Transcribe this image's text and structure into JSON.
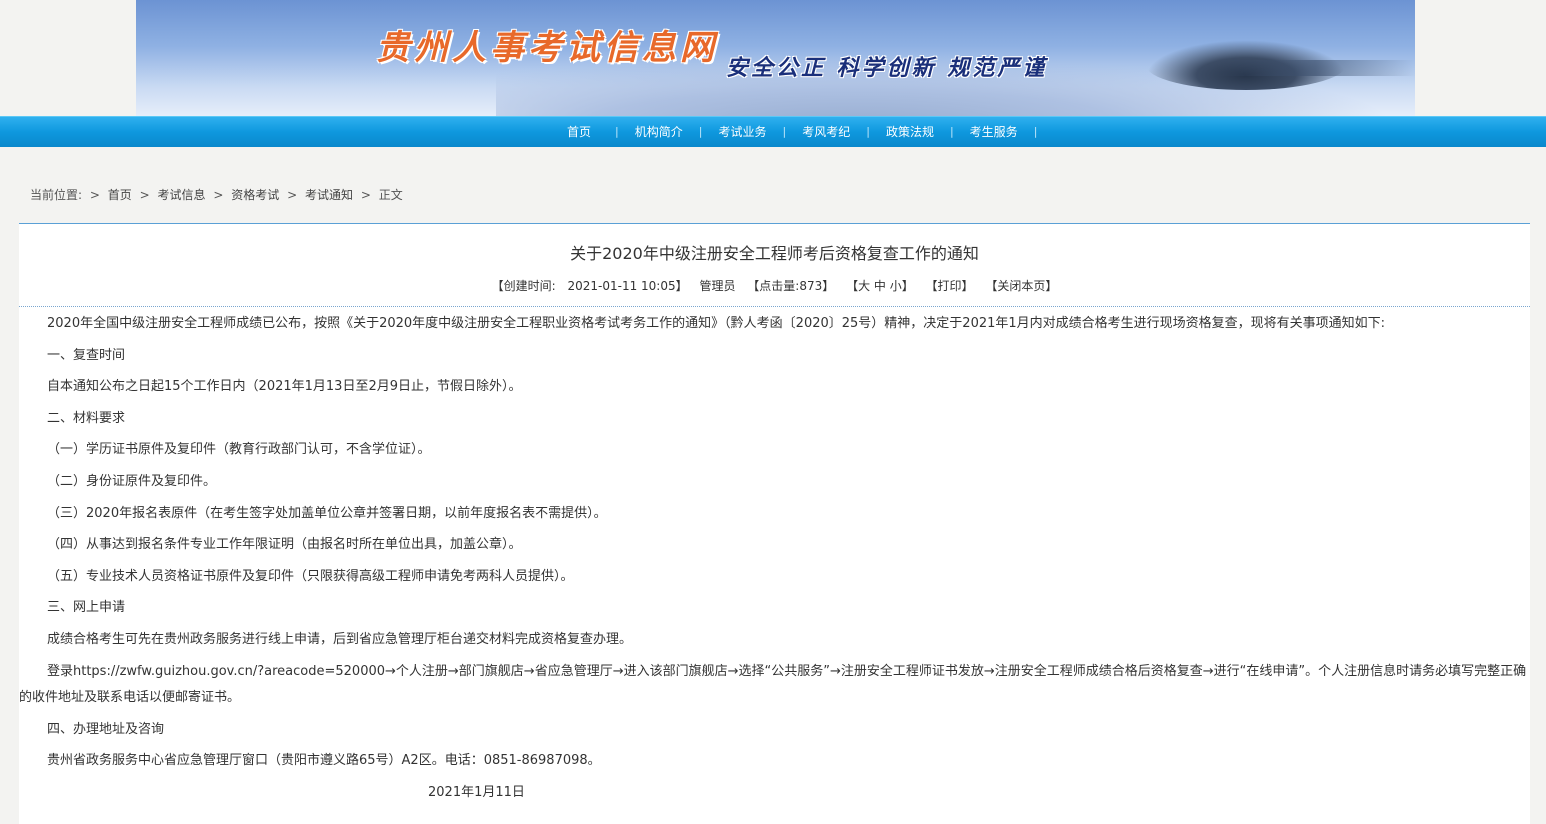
{
  "header": {
    "site_title": "贵州人事考试信息网",
    "slogan": "安全公正 科学创新 规范严谨"
  },
  "nav": {
    "items": [
      {
        "label": "首页"
      },
      {
        "label": "机构简介"
      },
      {
        "label": "考试业务"
      },
      {
        "label": "考风考纪"
      },
      {
        "label": "政策法规"
      },
      {
        "label": "考生服务"
      }
    ],
    "separator": "|"
  },
  "breadcrumb": {
    "prefix": "当前位置:",
    "arrow": ">",
    "items": [
      "首页",
      "考试信息",
      "资格考试",
      "考试通知",
      "正文"
    ]
  },
  "article": {
    "title": "关于2020年中级注册安全工程师考后资格复查工作的通知",
    "meta": {
      "created_label": "【创建时间:",
      "created_value": "2021-01-11 10:05】",
      "author": "管理员",
      "clicks": "【点击量:873】",
      "font_size": "【大 中 小】",
      "print": "【打印】",
      "close": "【关闭本页】"
    },
    "paragraphs": [
      "2020年全国中级注册安全工程师成绩已公布，按照《关于2020年度中级注册安全工程职业资格考试考务工作的通知》（黔人考函〔2020〕25号）精神，决定于2021年1月内对成绩合格考生进行现场资格复查，现将有关事项通知如下:",
      "一、复查时间",
      "自本通知公布之日起15个工作日内（2021年1月13日至2月9日止，节假日除外）。",
      "二、材料要求",
      "（一）学历证书原件及复印件（教育行政部门认可，不含学位证）。",
      "（二）身份证原件及复印件。",
      "（三）2020年报名表原件（在考生签字处加盖单位公章并签署日期，以前年度报名表不需提供）。",
      "（四）从事达到报名条件专业工作年限证明（由报名时所在单位出具，加盖公章）。",
      "（五）专业技术人员资格证书原件及复印件（只限获得高级工程师申请免考两科人员提供）。",
      "三、网上申请",
      "成绩合格考生可先在贵州政务服务进行线上申请，后到省应急管理厅柜台递交材料完成资格复查办理。",
      "登录https://zwfw.guizhou.gov.cn/?areacode=520000→个人注册→部门旗舰店→省应急管理厅→进入该部门旗舰店→选择“公共服务”→注册安全工程师证书发放→注册安全工程师成绩合格后资格复查→进行“在线申请”。个人注册信息时请务必填写完整正确的收件地址及联系电话以便邮寄证书。",
      "四、办理地址及咨询",
      "贵州省政务服务中心省应急管理厅窗口（贵阳市遵义路65号）A2区。电话：0851-86987098。"
    ],
    "date": "2021年1月11日"
  }
}
